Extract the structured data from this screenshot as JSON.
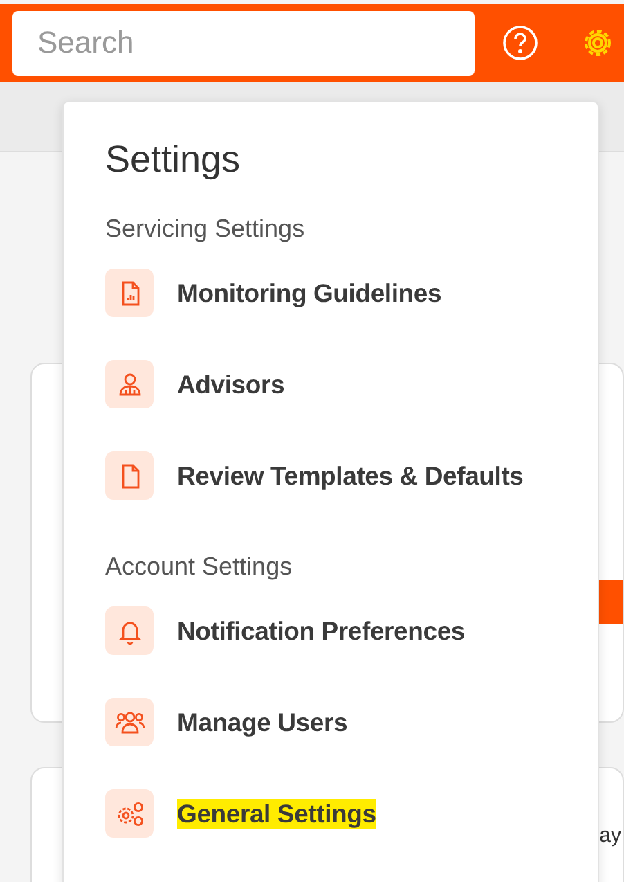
{
  "header": {
    "search": {
      "placeholder": "Search"
    },
    "settings_active": true
  },
  "background": {
    "partial_heading": "ay"
  },
  "settings_menu": {
    "title": "Settings",
    "sections": [
      {
        "heading": "Servicing Settings",
        "items": [
          {
            "label": "Monitoring Guidelines",
            "highlighted": false
          },
          {
            "label": "Advisors",
            "highlighted": false
          },
          {
            "label": "Review Templates & Defaults",
            "highlighted": false
          }
        ]
      },
      {
        "heading": "Account Settings",
        "items": [
          {
            "label": "Notification Preferences",
            "highlighted": false
          },
          {
            "label": "Manage Users",
            "highlighted": false
          },
          {
            "label": "General Settings",
            "highlighted": true
          }
        ]
      }
    ]
  }
}
